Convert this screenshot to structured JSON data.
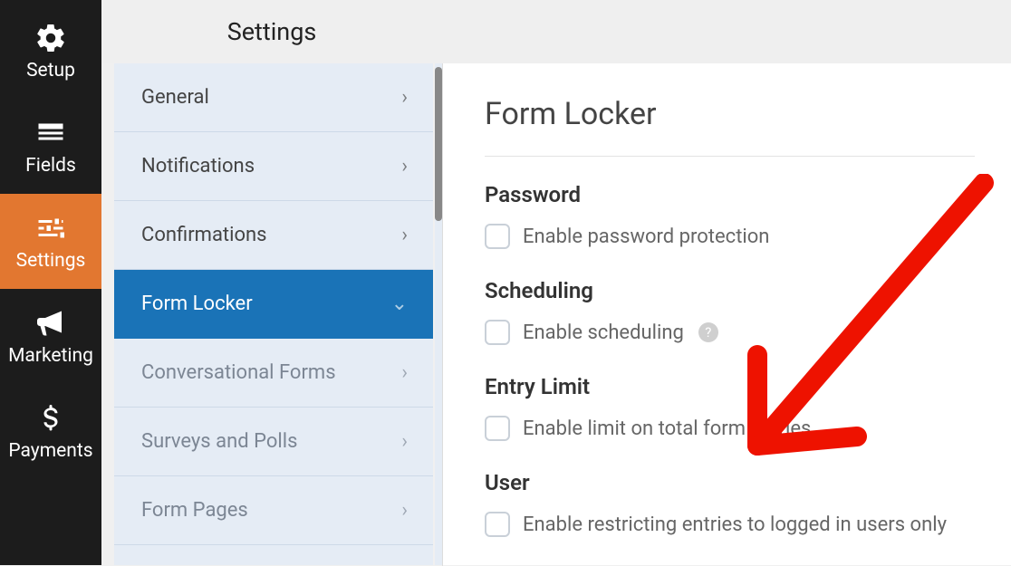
{
  "topbar": {
    "title": "Settings"
  },
  "rail": [
    {
      "label": "Setup"
    },
    {
      "label": "Fields"
    },
    {
      "label": "Settings"
    },
    {
      "label": "Marketing"
    },
    {
      "label": "Payments"
    }
  ],
  "menu": [
    {
      "label": "General"
    },
    {
      "label": "Notifications"
    },
    {
      "label": "Confirmations"
    },
    {
      "label": "Form Locker"
    },
    {
      "label": "Conversational Forms"
    },
    {
      "label": "Surveys and Polls"
    },
    {
      "label": "Form Pages"
    }
  ],
  "page": {
    "title": "Form Locker",
    "sections": {
      "password": {
        "heading": "Password",
        "checkbox_label": "Enable password protection"
      },
      "scheduling": {
        "heading": "Scheduling",
        "checkbox_label": "Enable scheduling"
      },
      "entrylimit": {
        "heading": "Entry Limit",
        "checkbox_label": "Enable limit on total form entries"
      },
      "user": {
        "heading": "User",
        "checkbox_label": "Enable restricting entries to logged in users only"
      }
    }
  }
}
